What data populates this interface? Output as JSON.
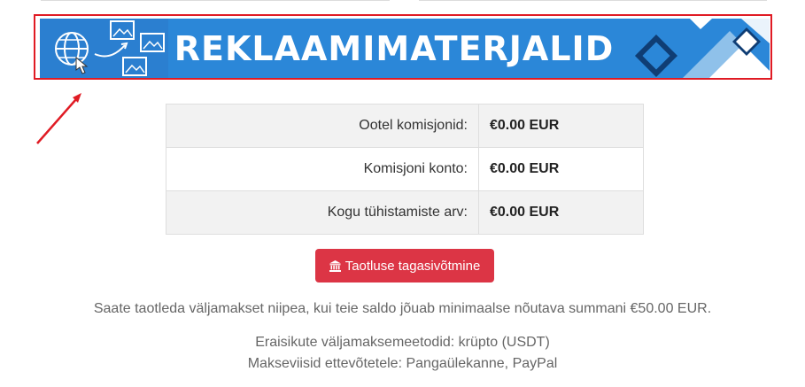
{
  "banner": {
    "title": "REKLAAMIMATERJALID",
    "bg_color": "#2b87d8",
    "highlight_border_color": "#e01b24"
  },
  "stats": [
    {
      "label": "Ootel komisjonid:",
      "value": "€0.00 EUR"
    },
    {
      "label": "Komisjoni konto:",
      "value": "€0.00 EUR"
    },
    {
      "label": "Kogu tühistamiste arv:",
      "value": "€0.00 EUR"
    }
  ],
  "withdraw_button": {
    "label": "Taotluse tagasivõtmine",
    "icon": "bank-icon",
    "color": "#dc3545"
  },
  "info": {
    "min_payout": "Saate taotleda väljamakset niipea, kui teie saldo jõuab minimaalse nõutava summani €50.00 EUR.",
    "private_methods": "Eraisikute väljamaksemeetodid: krüpto (USDT)",
    "business_methods": "Makseviisid ettevõtetele: Pangaülekanne, PayPal"
  }
}
